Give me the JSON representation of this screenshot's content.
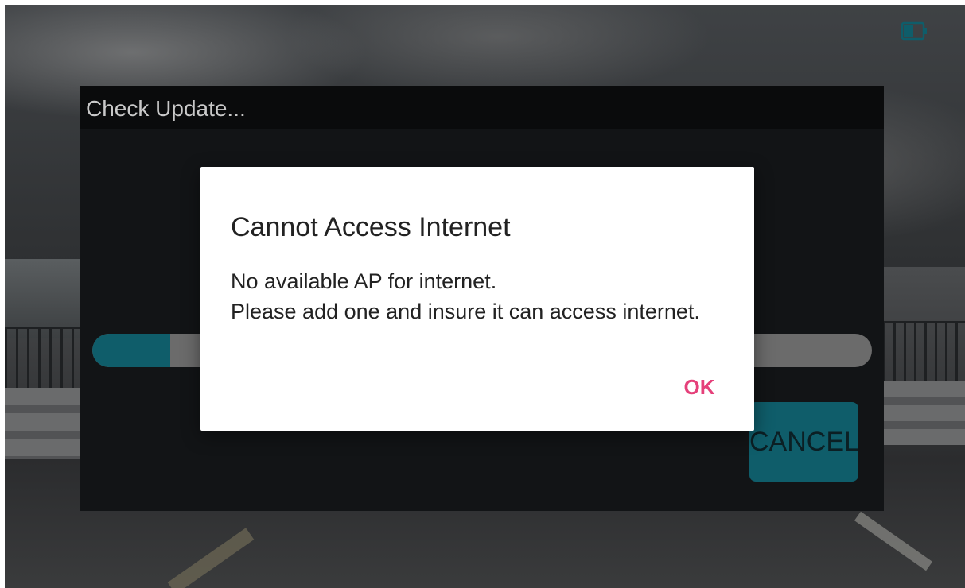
{
  "status": {
    "battery_icon": "battery-icon",
    "battery_color": "#0f5d6a"
  },
  "update_panel": {
    "title": "Check Update...",
    "progress_fraction": 0.1,
    "cancel_label": "CANCEL"
  },
  "dialog": {
    "title": "Cannot Access Internet",
    "message_lines": [
      "No available AP for internet.",
      "Please add one and insure it can access internet."
    ],
    "ok_label": "OK",
    "ok_color": "#e5407a"
  },
  "colors": {
    "accent": "#0f5d6a",
    "panel": "#121416"
  }
}
